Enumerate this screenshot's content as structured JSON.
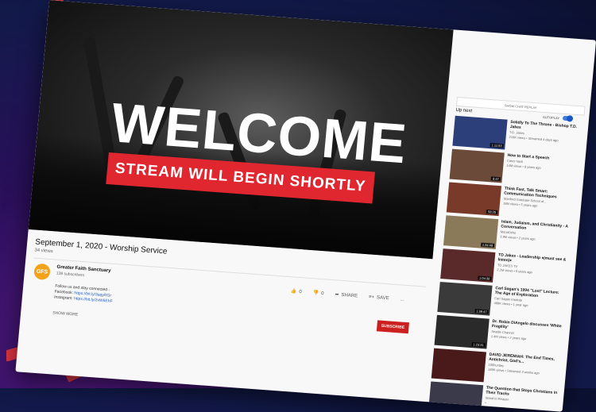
{
  "player": {
    "welcome_text": "WELCOME",
    "banner_text": "STREAM WILL BEGIN SHORTLY"
  },
  "video": {
    "title": "September 1, 2020 - Worship Service",
    "views": "34 views",
    "like_count": "0",
    "dislike_count": "0",
    "share_label": "SHARE",
    "save_label": "SAVE",
    "more_label": "..."
  },
  "channel": {
    "avatar_text": "GFS",
    "name": "Greater Faith Sanctuary",
    "subscribers": "138 subscribers",
    "subscribe_label": "SUBSCRIBE"
  },
  "description": {
    "line1": "Follow us and stay connected -",
    "facebook_label": "Facebook:",
    "facebook_link": "https://bit.ly/3aqyRGr",
    "instagram_label": "Instagram:",
    "instagram_link": "https://bit.ly/2vW6EhF",
    "show_more": "SHOW MORE"
  },
  "sidebar": {
    "chat_replay": "SHOW CHAT REPLAY",
    "up_next": "Up next",
    "autoplay_label": "AUTOPLAY",
    "items": [
      {
        "title": "Solidly To The Throne - Bishop T.D. Jakes",
        "channel": "T.D. Jakes",
        "views": "218K views",
        "age": "Streamed 4 days ago",
        "duration": "1:11:53"
      },
      {
        "title": "How to Start a Speech",
        "channel": "Conor Neill",
        "views": "14M views",
        "age": "8 years ago",
        "duration": "8:47"
      },
      {
        "title": "Think Fast, Talk Smart: Communication Techniques",
        "channel": "Stanford Graduate School of...",
        "views": "18M views",
        "age": "5 years ago",
        "duration": "58:20"
      },
      {
        "title": "Islam, Judaism, and Christianity - A Conversation",
        "channel": "MoralOrNo",
        "views": "3.9M views",
        "age": "2 years ago",
        "duration": "1:34:49"
      },
      {
        "title": "TD Jakes - Leadership ♦(must see & listen)♦",
        "channel": "TD JAKES TV",
        "views": "2.2M views",
        "age": "5 years ago",
        "duration": "1:04:38"
      },
      {
        "title": "Carl Sagan's 1994 \"Lost\" Lecture: The Age of Exploration",
        "channel": "Carl Sagan Institute",
        "views": "489K views",
        "age": "1 year ago",
        "duration": "1:36:47"
      },
      {
        "title": "Dr. Robin DiAngelo discusses 'White Fragility'",
        "channel": "Seattle Channel",
        "views": "1.4M views",
        "age": "2 years ago",
        "duration": "1:23:31"
      },
      {
        "title": "DAVID JEREMIAH: The End Times, Antichrist, God's...",
        "channel": "100huntley",
        "views": "189K views",
        "age": "Streamed 3 weeks ago",
        "duration": ""
      },
      {
        "title": "The Question that Stops Christians in Their Tracks",
        "channel": "Stand to Reason",
        "views": "",
        "age": "",
        "duration": ""
      }
    ]
  },
  "colors": {
    "brand_red": "#e0262f",
    "subscribe_red": "#cc1f1f",
    "link_blue": "#1a5fd6",
    "avatar_orange": "#f2a319"
  }
}
